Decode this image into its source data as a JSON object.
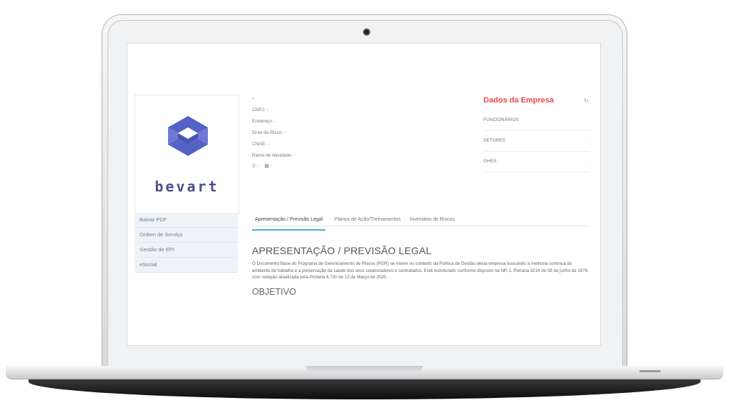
{
  "sidebar": {
    "logo_text": "bevart",
    "items": [
      {
        "label": "Baixar PDF"
      },
      {
        "label": "Ordem de Serviço"
      },
      {
        "label": "Gestão de EPI"
      },
      {
        "label": "eSocial"
      }
    ]
  },
  "company": {
    "name": "-",
    "cnpj": "CNPJ: -",
    "endereco": "Endereço: -",
    "grau_risco": "Grau de Risco: -",
    "cnae": "CNAE: -",
    "ramo": "Ramo de Atividade: -",
    "location_value": "-",
    "date_value": "-"
  },
  "panel": {
    "title": "Dados da Empresa",
    "rows": [
      {
        "label": "FUNCIONÁRIOS",
        "value": "-"
      },
      {
        "label": "SETORES",
        "value": "-"
      },
      {
        "label": "GHES",
        "value": "-"
      }
    ]
  },
  "tabs": [
    {
      "label": "Apresentação / Previsão Legal"
    },
    {
      "label": "Planos de Ação/Treinamentos"
    },
    {
      "label": "Inventário de Riscos"
    }
  ],
  "content": {
    "heading": "APRESENTAÇÃO / PREVISÃO LEGAL",
    "paragraph": "O Documento Base do Programa de Gerenciamento de Riscos (PGR) se insere no contexto da Política de Gestão desta empresa buscando a melhoria contínua do ambiente de trabalho e a preservação da saúde dos seus colaboradores e contratados. Está estruturado conforme disposto na NR-1, Portaria 3214 de 08 de junho de 1978, com redação atualizada pela Portaria 6.730 de 12 de Março de 2020.",
    "subheading": "OBJETIVO"
  },
  "colors": {
    "accent": "#4ab3d4",
    "title_red": "#e64c4c",
    "logo_blue": "#5661c4"
  },
  "icons": [
    "refresh-icon",
    "map-pin-icon",
    "calendar-icon",
    "camera-icon"
  ]
}
